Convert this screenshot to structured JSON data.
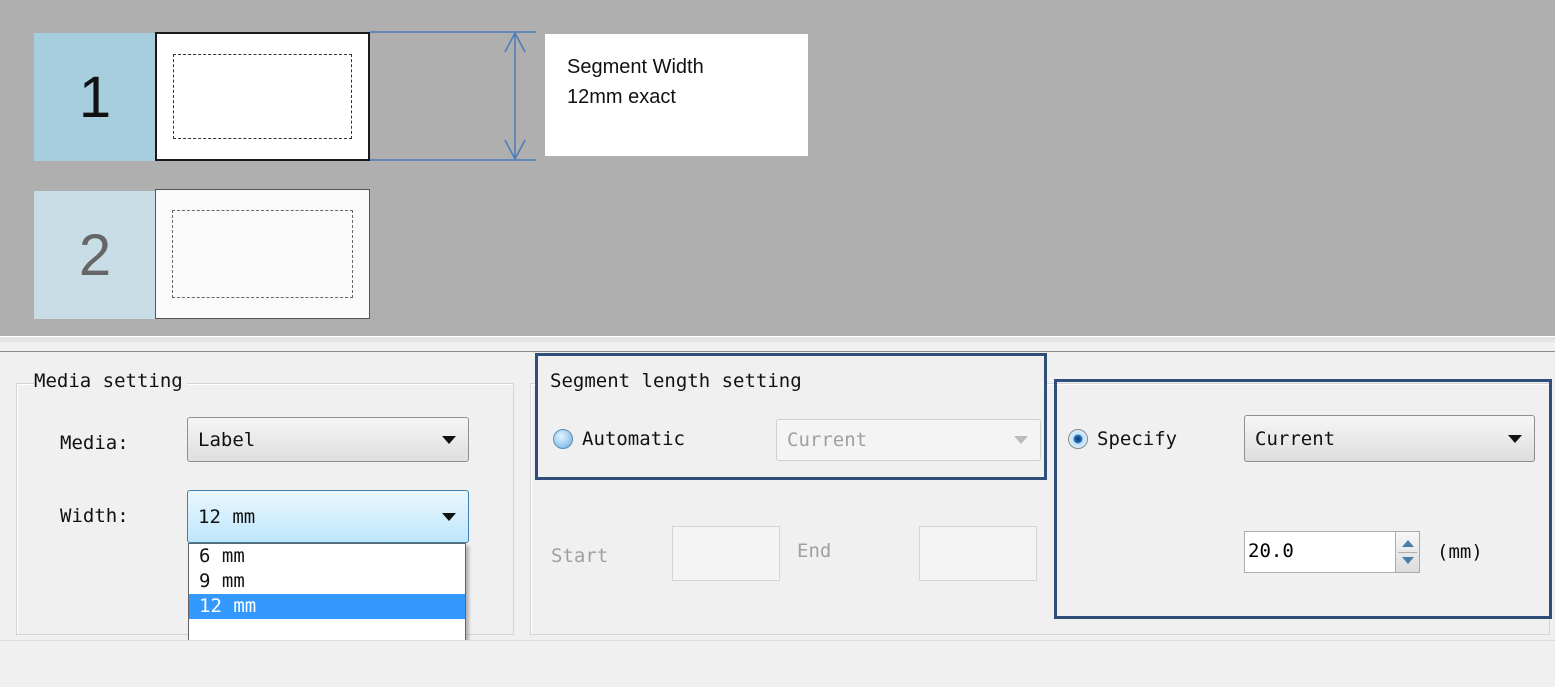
{
  "preview": {
    "segments": [
      {
        "number": "1"
      },
      {
        "number": "2"
      }
    ],
    "callout": {
      "line1": "Segment Width",
      "line2": "12mm exact"
    }
  },
  "media_setting": {
    "title": "Media setting",
    "media_label": "Media:",
    "media_value": "Label",
    "width_label": "Width:",
    "width_value": "12 mm",
    "width_options": [
      "6 mm",
      "9 mm",
      "12 mm"
    ],
    "width_selected_index": 2
  },
  "segment_length": {
    "title": "Segment length setting",
    "automatic_label": "Automatic",
    "automatic_selected": false,
    "automatic_combo_value": "Current",
    "start_label": "Start",
    "end_label": "End",
    "specify_label": "Specify",
    "specify_selected": true,
    "specify_combo_value": "Current",
    "length_value": "20.0",
    "unit_label": "(mm)"
  },
  "colors": {
    "preview_bg": "#afafaf",
    "segment1_tab": "#a7cede",
    "segment2_tab": "#c9dde6",
    "highlight_border": "#2f4e78",
    "selection": "#3399ff"
  }
}
